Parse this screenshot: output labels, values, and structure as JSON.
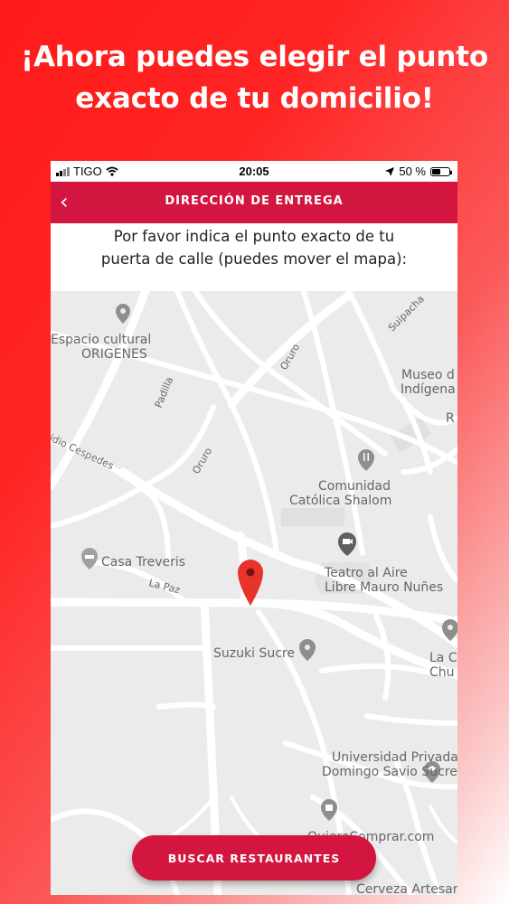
{
  "headline": {
    "line1": "¡Ahora puedes elegir el punto",
    "line2": "exacto de tu domicilio!"
  },
  "status_bar": {
    "carrier": "TIGO",
    "time": "20:05",
    "battery": "50 %",
    "battery_level": 0.5,
    "icons": [
      "signal-bars-icon",
      "wifi-icon",
      "location-arrow-icon",
      "battery-icon"
    ]
  },
  "app_bar": {
    "back_glyph": "‹",
    "title": "DIRECCIÓN DE ENTREGA"
  },
  "instruction": {
    "line1": "Por favor indica el punto exacto de tu",
    "line2": "puerta de calle (puedes mover el mapa):"
  },
  "map": {
    "places": {
      "espacio_1": "Espacio cultural",
      "espacio_2": "ORIGENES",
      "museo_1": "Museo d",
      "museo_2": "Indígena",
      "comunidad_1": "Comunidad",
      "comunidad_2": "Católica Shalom",
      "casa": "Casa Treveris",
      "teatro_1": "Teatro al Aire",
      "teatro_2": "Libre Mauro Nuñes",
      "suzuki": "Suzuki Sucre",
      "la_c_1": "La C",
      "la_c_2": "Chu",
      "universidad_1": "Universidad Privada",
      "universidad_2": "Domingo Savio Sucre",
      "quiero": "QuieroComprar.com",
      "cerveza": "Cerveza Artesar",
      "edge_r": "R"
    },
    "streets": {
      "oruro_1": "Oruro",
      "oruro_2": "Oruro",
      "padilla": "Padilla",
      "suipacha": "Suipacha",
      "cespedes": "idio Cespedes",
      "la_paz": "La Paz"
    },
    "icons": [
      "place-pin-icon",
      "restaurant-icon",
      "camera-pin-icon",
      "hotel-icon",
      "education-icon",
      "shopping-icon",
      "delivery-location-marker-icon"
    ],
    "colors": {
      "map_bg": "#ebebeb",
      "road": "#ffffff",
      "marker": "#e8332c",
      "poi": "#8e8e8e"
    }
  },
  "cta": {
    "label": "BUSCAR RESTAURANTES"
  },
  "colors": {
    "brand": "#d2163f",
    "gradient_start": "#ff1a1a",
    "gradient_end": "#ffffff"
  }
}
